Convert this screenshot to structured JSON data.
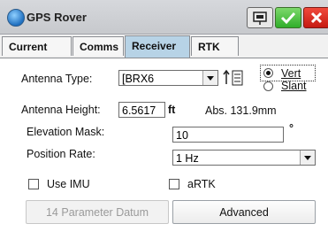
{
  "window": {
    "title": "GPS Rover"
  },
  "tabs": [
    {
      "label": "Current"
    },
    {
      "label": "Comms"
    },
    {
      "label": "Receiver"
    },
    {
      "label": "RTK"
    }
  ],
  "active_tab": "Receiver",
  "antenna_type": {
    "label": "Antenna Type:",
    "value": "[BRX6"
  },
  "measure_mode": {
    "options": [
      {
        "label": "Vert",
        "selected": true
      },
      {
        "label": "Slant",
        "selected": false
      }
    ]
  },
  "antenna_height": {
    "label": "Antenna Height:",
    "value": "6.5617",
    "unit": "ft",
    "abs_text": "Abs. 131.9mm"
  },
  "elevation_mask": {
    "label": "Elevation Mask:",
    "value": "10",
    "unit": "°"
  },
  "position_rate": {
    "label": "Position Rate:",
    "value": "1 Hz"
  },
  "use_imu": {
    "label": "Use IMU",
    "checked": false
  },
  "artk": {
    "label": "aRTK",
    "checked": false
  },
  "buttons": {
    "parameter_datum": "14 Parameter Datum",
    "advanced": "Advanced"
  },
  "colors": {
    "active_tab": "#b7d3e6",
    "ok": "#2fae2a",
    "close": "#c61a12"
  }
}
